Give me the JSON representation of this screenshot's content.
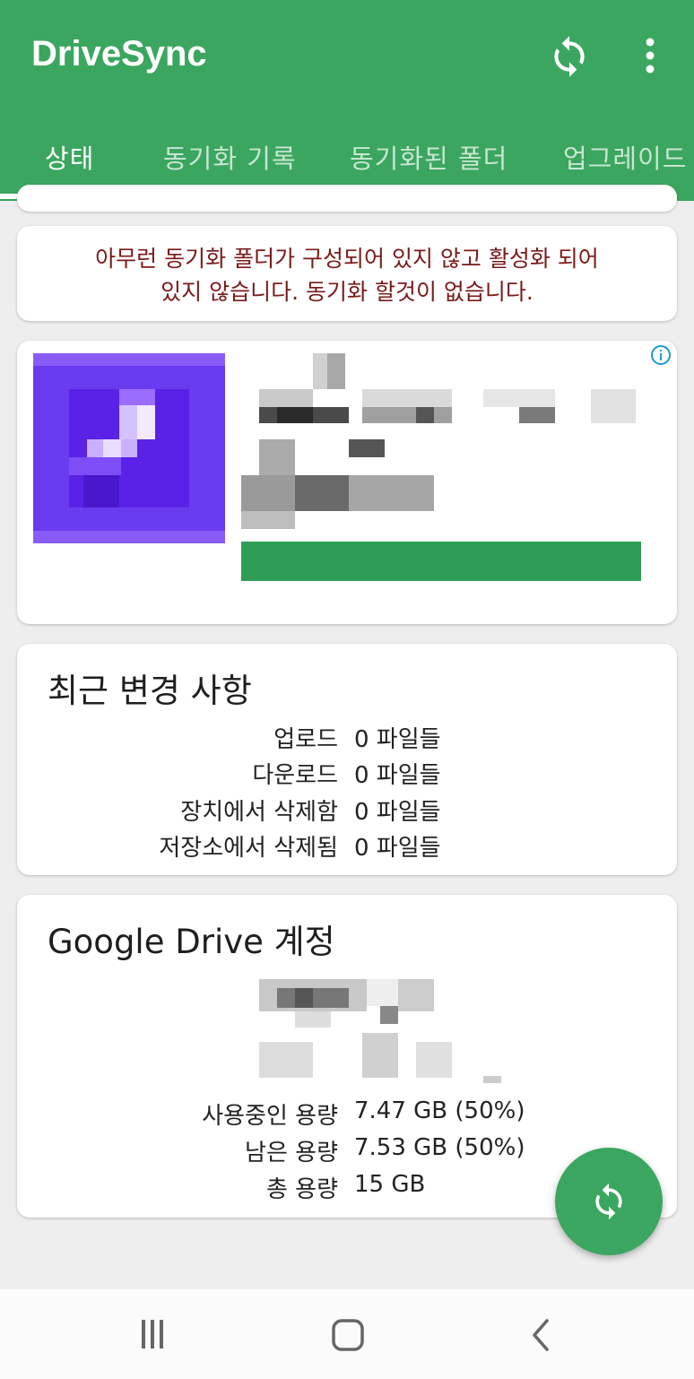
{
  "app": {
    "title": "DriveSync",
    "accent": "#3ba65f"
  },
  "tabs": [
    {
      "label": "상태",
      "active": true
    },
    {
      "label": "동기화 기록",
      "active": false
    },
    {
      "label": "동기화된 폴더",
      "active": false
    },
    {
      "label": "업그레이드",
      "active": false
    }
  ],
  "warning": {
    "line1": "아무런 동기화 폴더가 구성되어 있지 않고 활성화 되어",
    "line2": "있지 않습니다. 동기화 할것이 없습니다.",
    "color": "#7a1a1a"
  },
  "recent_changes": {
    "title": "최근 변경 사항",
    "rows": [
      {
        "label": "업로드",
        "value": "0 파일들"
      },
      {
        "label": "다운로드",
        "value": "0 파일들"
      },
      {
        "label": "장치에서 삭제함",
        "value": "0 파일들"
      },
      {
        "label": "저장소에서 삭제됨",
        "value": "0 파일들"
      }
    ]
  },
  "account": {
    "title": "Google Drive 계정",
    "rows": [
      {
        "label": "사용중인 용량",
        "value": "7.47 GB (50%)"
      },
      {
        "label": "남은 용량",
        "value": "7.53 GB (50%)"
      },
      {
        "label": "총 용량",
        "value": "15 GB"
      }
    ]
  },
  "icons": {
    "toolbar_sync": "sync-icon",
    "toolbar_more": "more-vert-icon",
    "fab": "sync-icon",
    "ad_info": "info-icon",
    "nav_recents": "recents-icon",
    "nav_home": "home-icon",
    "nav_back": "back-icon"
  }
}
